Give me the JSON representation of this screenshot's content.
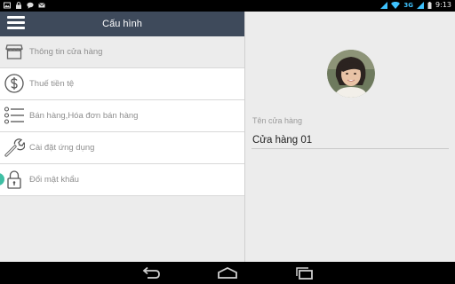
{
  "status_bar": {
    "left_icons": [
      "image-icon",
      "lock-icon",
      "chat-icon",
      "mail-icon"
    ],
    "right_icons": [
      "signal-icon",
      "wifi-icon",
      "battery-icon"
    ],
    "network": "3G",
    "time": "9:13"
  },
  "toolbar": {
    "title": "Cấu hình",
    "background": "#3e4a5b"
  },
  "menu": {
    "items": [
      {
        "label": "Thông tin cửa hàng",
        "icon": "store-icon",
        "selected": true
      },
      {
        "label": "Thuế tiền tệ",
        "icon": "dollar-icon",
        "selected": false
      },
      {
        "label": "Bán hàng,Hóa đơn bán hàng",
        "icon": "list-icon",
        "selected": false
      },
      {
        "label": "Cài đặt ứng dụng",
        "icon": "wrench-icon",
        "selected": false
      },
      {
        "label": "Đổi mật khẩu",
        "icon": "lock-icon",
        "selected": false
      }
    ]
  },
  "store_form": {
    "name_label": "Tên cửa hàng",
    "name_value": "Cửa hàng 01"
  },
  "nav_bar": {
    "buttons": [
      "back-icon",
      "home-icon",
      "recent-apps-icon"
    ]
  }
}
